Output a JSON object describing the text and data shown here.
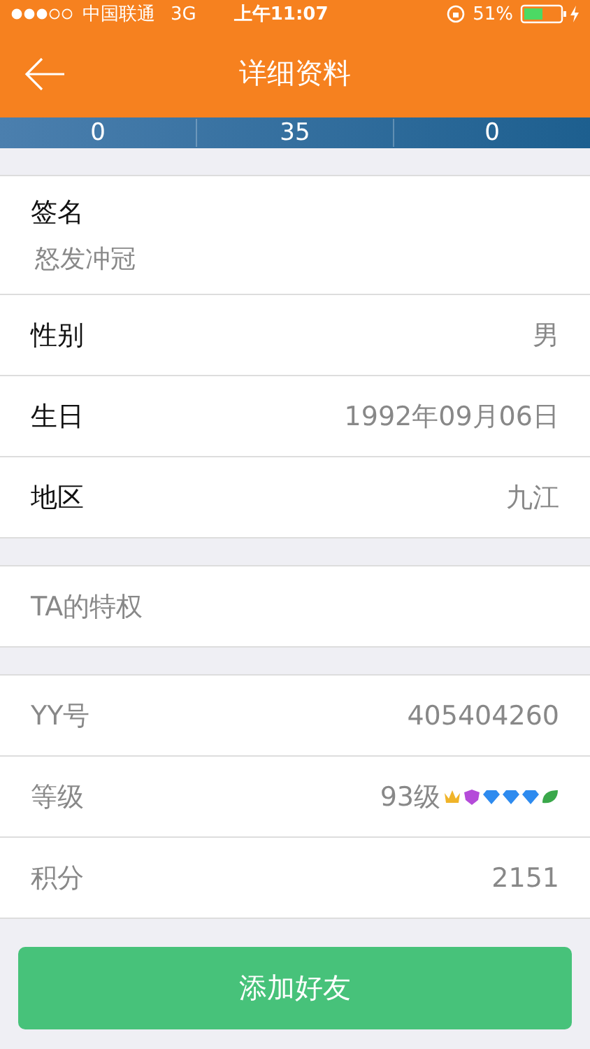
{
  "status_bar": {
    "carrier": "中国联通",
    "network": "3G",
    "time": "上午11:07",
    "battery": "51%"
  },
  "nav": {
    "title": "详细资料"
  },
  "stats": [
    "0",
    "35",
    "0"
  ],
  "sections": [
    {
      "rows": [
        {
          "kind": "stacked",
          "label": "签名",
          "value": "怒发冲冠"
        },
        {
          "kind": "normal",
          "label": "性别",
          "value": "男"
        },
        {
          "kind": "normal",
          "label": "生日",
          "value": "1992年09月06日"
        },
        {
          "kind": "normal",
          "label": "地区",
          "value": "九江"
        }
      ]
    },
    {
      "rows": [
        {
          "kind": "muted",
          "label": "TA的特权"
        }
      ]
    },
    {
      "rows": [
        {
          "kind": "muted",
          "label": "YY号",
          "value": "405404260"
        },
        {
          "kind": "muted",
          "label": "等级",
          "value": "93级",
          "badges": [
            {
              "kind": "crown"
            },
            {
              "kind": "shield"
            },
            {
              "kind": "diamond"
            },
            {
              "kind": "diamond"
            },
            {
              "kind": "diamond"
            },
            {
              "kind": "leaf"
            }
          ]
        },
        {
          "kind": "muted",
          "label": "积分",
          "value": "2151"
        }
      ]
    }
  ],
  "button": {
    "label": "添加好友"
  }
}
